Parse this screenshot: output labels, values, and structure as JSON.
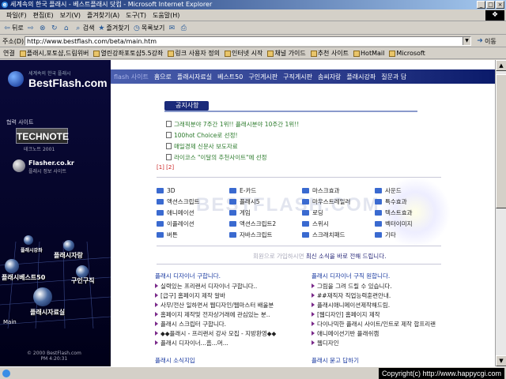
{
  "window": {
    "title": "세계속의 한국 플래시 - 베스트플래시 닷컴 - Microsoft Internet Explorer"
  },
  "menubar": {
    "items": [
      "파일(F)",
      "편집(E)",
      "보기(V)",
      "즐겨찾기(A)",
      "도구(T)",
      "도움말(H)"
    ]
  },
  "toolbar": {
    "back": "뒤로",
    "search": "검색",
    "favorites": "즐겨찾기",
    "history": "목록보기"
  },
  "address": {
    "label": "주소(D)",
    "url": "http://www.bestflash.com/beta/main.htm",
    "go": "이동"
  },
  "links": {
    "label": "연결",
    "items": [
      "플래시,포토샵,드림위버",
      "열린강좌포토샵5.5강좌",
      "링크 사용자 정의",
      "인터넷 시작",
      "채널 가이드",
      "추천 사이트",
      "HotMail",
      "Microsoft"
    ]
  },
  "sidebar": {
    "logo_sub": "세계속의 한국 플래시",
    "logo_text": "BestFlash.com",
    "partner_title": "협력 사이트",
    "technote": "TECHNOTE",
    "technote_sub": "테크노트 2001",
    "flasher": "Flasher.co.kr",
    "flasher_sub": "플래시 정보 사이트",
    "orb_labels": [
      "플래시강좌",
      "플래시자랑",
      "플래시베스트50",
      "구인구직",
      "플래시자료실"
    ],
    "main_label": "Main",
    "copyright": "© 2000 BestFlash.com",
    "time": "PM 4:20:31"
  },
  "nav": {
    "faded": "flash 사이트",
    "items": [
      "홈으로",
      "플래시자료실",
      "베스트50",
      "구인게시판",
      "구직게시판",
      "솜씨자랑",
      "플래시강좌",
      "질문과 답"
    ]
  },
  "notice": {
    "tab": "공지사항",
    "items": [
      "그래픽분야 7주간 1위!! 플래시분야 10주간 1위!!",
      "100hot Choice로 선정!",
      "매일경제 신문사 보도자료",
      "라이코스 \"이달의 추천사이트\"에 선정"
    ],
    "pager": "[1] [2]"
  },
  "categories": [
    [
      "3D",
      "E-카드",
      "마스크효과",
      "사운드"
    ],
    [
      "액션스크립트",
      "플래시5",
      "마우스트레일러",
      "특수효과"
    ],
    [
      "애니메이션",
      "게임",
      "로딩",
      "텍스트효과"
    ],
    [
      "이플레이션",
      "액션스크립트2",
      "스위시",
      "벡터이미지"
    ],
    [
      "버튼",
      "자바스크립트",
      "스크래치패드",
      "기타"
    ]
  ],
  "watermark": "BESTFLASH.COM",
  "signup": {
    "dim": "회원으로 가입하시면",
    "text": "최신 소식을 바로 전해 드립니다."
  },
  "boards": {
    "left": {
      "title": "플래시 디자이너 구합니다.",
      "items": [
        "실력있는 프리랜서 디자이너 구합니다..",
        "[급구] 홈페이지 제작 알바",
        "사무/전산 일하면서 웹디자인/웹마스터 배울분",
        "홈페이지 제작및 전자상거래에 관심있는 분..",
        "플래시 스크립터 구합니다.",
        "◆◆플래시 - 프리랜서 강사 모집 - 지방환영◆◆",
        "플래시 디자이너...흠...머..."
      ]
    },
    "right": {
      "title": "플래시 디자이너 구직 원합니다.",
      "items": [
        "그림을 그려 드릴 수 있습니다.",
        "##재직자 직업능력훈련안내.",
        "플래시애니메이션제작해드림.",
        "[웹디자인] 홈페이지 제작",
        "다이나믹한 플래시 사이트/인트로 제작 합프리랜",
        "애니메이션기반 플래쉬캠",
        "웹디자인"
      ]
    },
    "bottom_left": "플래시 소식지입",
    "bottom_right": "플래시 묻고 답하기"
  },
  "status": {
    "credit": "Copyright(c) http://www.happycgi.com"
  }
}
